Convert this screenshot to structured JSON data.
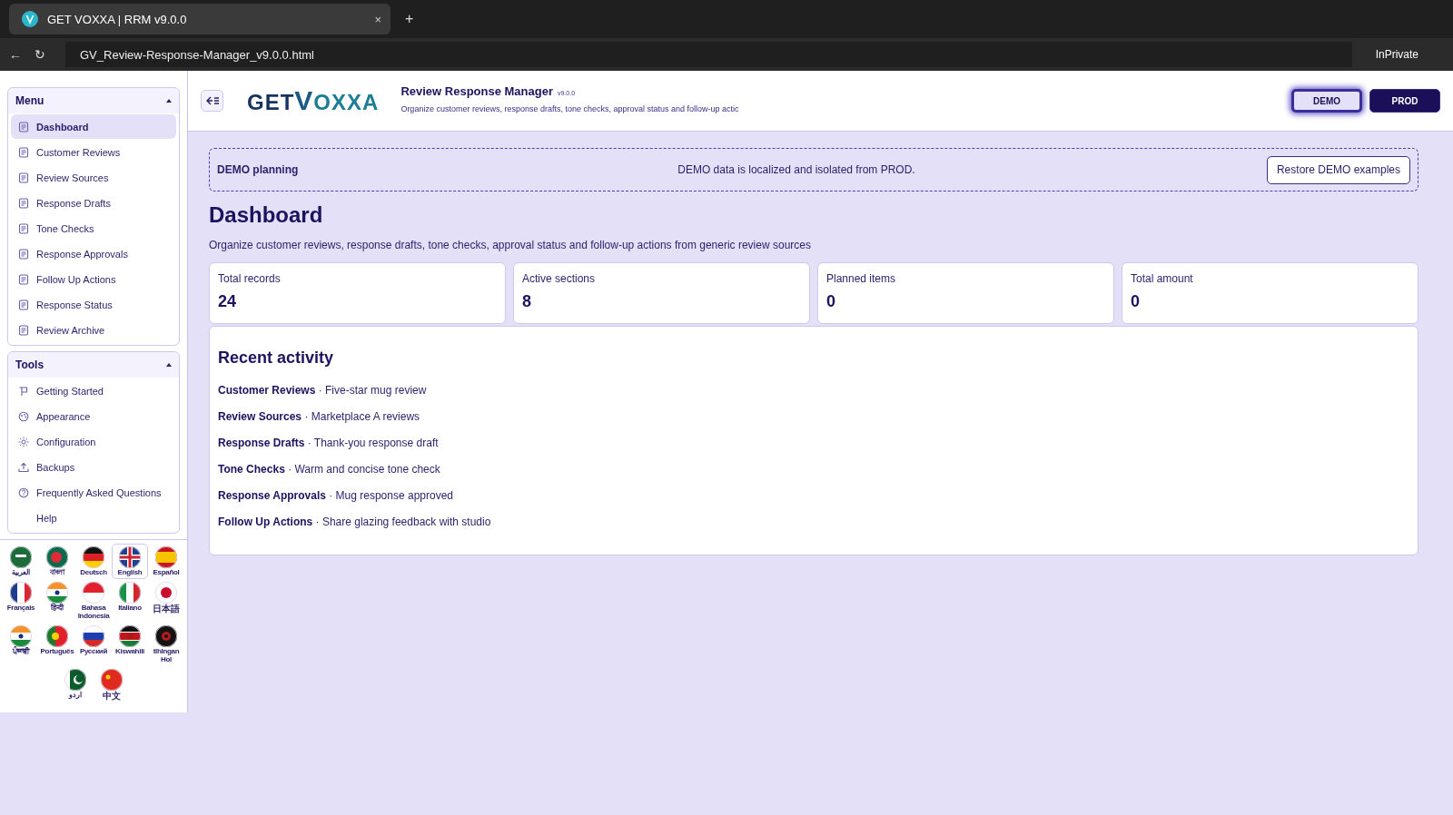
{
  "browser": {
    "tab_title": "GET VOXXA | RRM v9.0.0",
    "tab_close": "×",
    "new_tab": "+",
    "back": "←",
    "reload": "↻",
    "url": "GV_Review-Response-Manager_v9.0.0.html",
    "mode": "InPrivate"
  },
  "sidebar": {
    "menu": {
      "title": "Menu",
      "expanded": true,
      "items": [
        {
          "label": "Dashboard",
          "selected": true
        },
        {
          "label": "Customer Reviews",
          "selected": false
        },
        {
          "label": "Review Sources",
          "selected": false
        },
        {
          "label": "Response Drafts",
          "selected": false
        },
        {
          "label": "Tone Checks",
          "selected": false
        },
        {
          "label": "Response Approvals",
          "selected": false
        },
        {
          "label": "Follow Up Actions",
          "selected": false
        },
        {
          "label": "Response Status",
          "selected": false
        },
        {
          "label": "Review Archive",
          "selected": false
        }
      ]
    },
    "tools": {
      "title": "Tools",
      "expanded": true,
      "items": [
        {
          "label": "Getting Started"
        },
        {
          "label": "Appearance"
        },
        {
          "label": "Configuration"
        },
        {
          "label": "Backups"
        },
        {
          "label": "Frequently Asked Questions"
        },
        {
          "label": "Help"
        }
      ]
    },
    "languages": [
      {
        "label": "العربية",
        "selected": false
      },
      {
        "label": "বাংলা",
        "selected": false
      },
      {
        "label": "Deutsch",
        "selected": false
      },
      {
        "label": "English",
        "selected": true
      },
      {
        "label": "Español",
        "selected": false
      },
      {
        "label": "Français",
        "selected": false
      },
      {
        "label": "हिन्दी",
        "selected": false
      },
      {
        "label": "Bahasa Indonesia",
        "selected": false
      },
      {
        "label": "Italiano",
        "selected": false
      },
      {
        "label": "日本語",
        "selected": false
      },
      {
        "label": "ਪੰਜਾਬੀ",
        "selected": false
      },
      {
        "label": "Português",
        "selected": false
      },
      {
        "label": "Русский",
        "selected": false
      },
      {
        "label": "Kiswahili",
        "selected": false
      },
      {
        "label": "tlhIngan Hol",
        "selected": false
      },
      {
        "label": "اردو",
        "selected": false
      },
      {
        "label": "中文",
        "selected": false
      }
    ]
  },
  "header": {
    "logo_left": "GET",
    "logo_mid": "V",
    "logo_right": "OXXA",
    "title": "Review Response Manager",
    "version": "v9.0.0",
    "subtitle": "Organize customer reviews, response drafts, tone checks, approval status and follow-up actic",
    "environments": [
      {
        "label": "DEMO",
        "selected": true
      },
      {
        "label": "PROD",
        "selected": false
      }
    ]
  },
  "banner": {
    "title": "DEMO planning",
    "message": "DEMO data is localized and isolated from PROD.",
    "button": "Restore DEMO examples"
  },
  "page": {
    "title": "Dashboard",
    "description": "Organize customer reviews, response drafts, tone checks, approval status and follow-up actions from generic review sources"
  },
  "stats": [
    {
      "label": "Total records",
      "value": "24"
    },
    {
      "label": "Active sections",
      "value": "8"
    },
    {
      "label": "Planned items",
      "value": "0"
    },
    {
      "label": "Total amount",
      "value": "0"
    }
  ],
  "recent": {
    "title": "Recent activity",
    "items": [
      {
        "section": "Customer Reviews",
        "separator": "·",
        "text": "Five-star mug review"
      },
      {
        "section": "Review Sources",
        "separator": "·",
        "text": "Marketplace A reviews"
      },
      {
        "section": "Response Drafts",
        "separator": "·",
        "text": "Thank-you response draft"
      },
      {
        "section": "Tone Checks",
        "separator": "·",
        "text": "Warm and concise tone check"
      },
      {
        "section": "Response Approvals",
        "separator": "·",
        "text": "Mug response approved"
      },
      {
        "section": "Follow Up Actions",
        "separator": "·",
        "text": "Share glazing feedback with studio"
      }
    ]
  }
}
